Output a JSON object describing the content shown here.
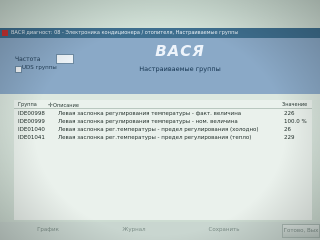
{
  "window": {
    "title": "ВАСЯ диагност: 08 - Электроника кондиционера / отопителя, Настраиваемые группы"
  },
  "header": {
    "brand": "ВАСЯ",
    "subtitle": "Настраиваемые группы"
  },
  "controls": {
    "frequency_label": "Частота",
    "frequency_value": "",
    "uds_groups_label": "UDS группы"
  },
  "table": {
    "columns": {
      "group": "Группа",
      "description": "Описание",
      "value": "Значение"
    },
    "rows": [
      {
        "group": "IDE00998",
        "description": "Левая заслонка регулирования температуры - факт. величина",
        "value": "226"
      },
      {
        "group": "IDE00999",
        "description": "Левая заслонка регулирования температуры - ном. величина",
        "value": "100.0 %"
      },
      {
        "group": "IDE01040",
        "description": "Левая заслонка рег.температуры - предел регулирования (холодно)",
        "value": "26"
      },
      {
        "group": "IDE01041",
        "description": "Левая заслонка рег.температуры - предел регулирования (тепло)",
        "value": "229"
      }
    ]
  },
  "footer": {
    "graph_label": "График",
    "log_label": "Журнал",
    "save_label": "Сохранить",
    "ready_label": "Готово, Вых"
  }
}
